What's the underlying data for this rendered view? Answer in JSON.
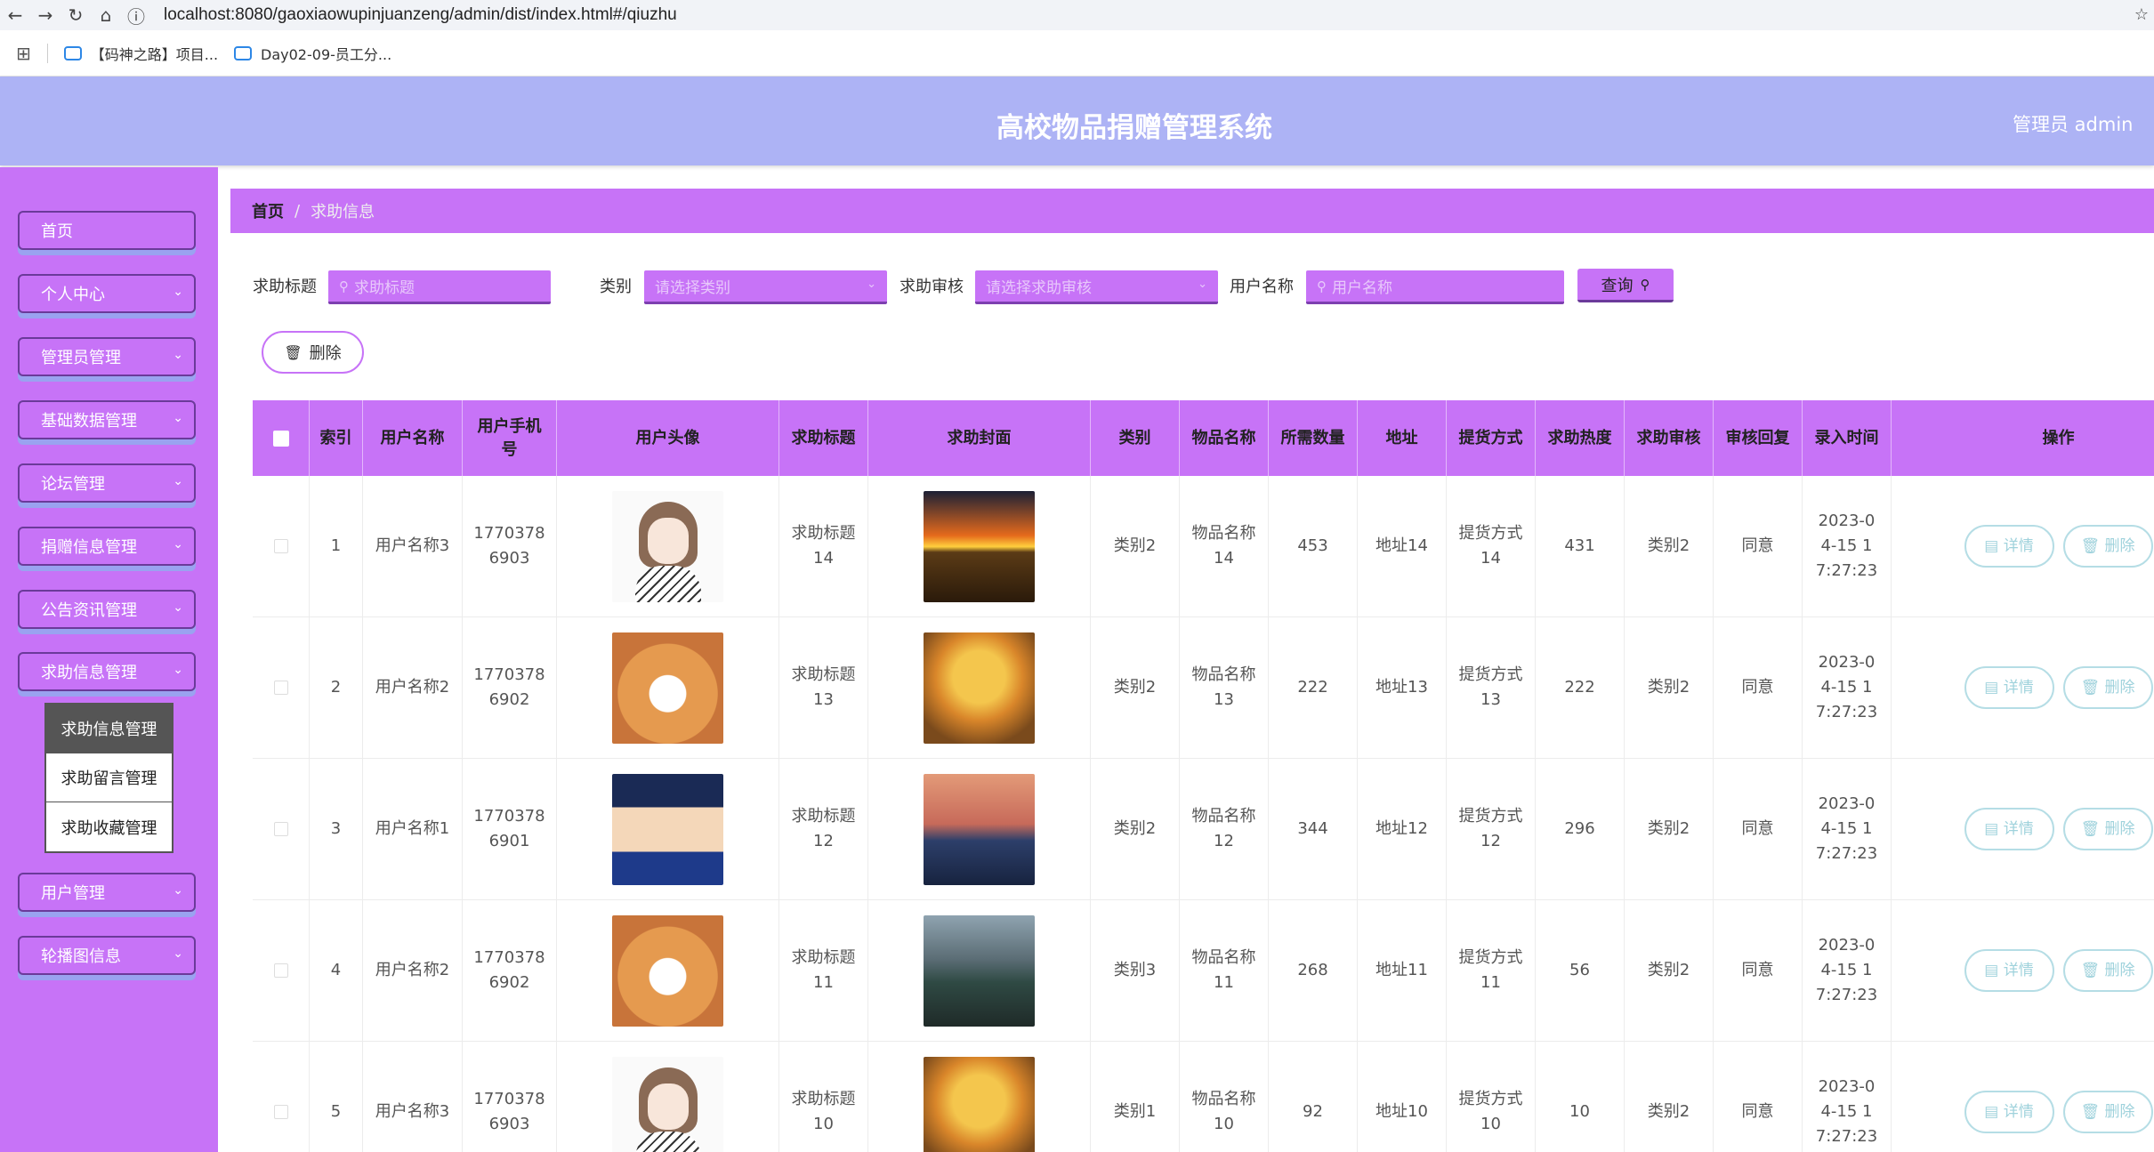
{
  "browser": {
    "url": "localhost:8080/gaoxiaowupinjuanzeng/admin/dist/index.html#/qiuzhu",
    "bookmarks": [
      "【码神之路】项目...",
      "Day02-09-员工分..."
    ]
  },
  "header": {
    "title": "高校物品捐赠管理系统",
    "user": "管理员 admin"
  },
  "sidebar": {
    "items": [
      {
        "label": "首页"
      },
      {
        "label": "个人中心"
      },
      {
        "label": "管理员管理"
      },
      {
        "label": "基础数据管理"
      },
      {
        "label": "论坛管理"
      },
      {
        "label": "捐赠信息管理"
      },
      {
        "label": "公告资讯管理"
      },
      {
        "label": "求助信息管理"
      },
      {
        "label": "用户管理"
      },
      {
        "label": "轮播图信息"
      }
    ],
    "submenu": [
      {
        "label": "求助信息管理"
      },
      {
        "label": "求助留言管理"
      },
      {
        "label": "求助收藏管理"
      }
    ]
  },
  "breadcrumb": {
    "home": "首页",
    "sep": "/",
    "current": "求助信息"
  },
  "search": {
    "title_label": "求助标题",
    "title_placeholder": "求助标题",
    "category_label": "类别",
    "category_placeholder": "请选择类别",
    "review_label": "求助审核",
    "review_placeholder": "请选择求助审核",
    "user_label": "用户名称",
    "user_placeholder": "用户名称",
    "query_label": "查询"
  },
  "delete_label": "删除",
  "table": {
    "headers": [
      "索引",
      "用户名称",
      "用户手机号",
      "用户头像",
      "求助标题",
      "求助封面",
      "类别",
      "物品名称",
      "所需数量",
      "地址",
      "提货方式",
      "求助热度",
      "求助审核",
      "审核回复",
      "录入时间",
      "操作"
    ],
    "rows": [
      {
        "index": "1",
        "user": "用户名称3",
        "phone": "17703786903",
        "title": "求助标题14",
        "category": "类别2",
        "item": "物品名称14",
        "qty": "453",
        "addr": "地址14",
        "pickup": "提货方式14",
        "heat": "431",
        "review": "类别2",
        "reply": "同意",
        "time": "2023-04-15 17:27:23"
      },
      {
        "index": "2",
        "user": "用户名称2",
        "phone": "17703786902",
        "title": "求助标题13",
        "category": "类别2",
        "item": "物品名称13",
        "qty": "222",
        "addr": "地址13",
        "pickup": "提货方式13",
        "heat": "222",
        "review": "类别2",
        "reply": "同意",
        "time": "2023-04-15 17:27:23"
      },
      {
        "index": "3",
        "user": "用户名称1",
        "phone": "17703786901",
        "title": "求助标题12",
        "category": "类别2",
        "item": "物品名称12",
        "qty": "344",
        "addr": "地址12",
        "pickup": "提货方式12",
        "heat": "296",
        "review": "类别2",
        "reply": "同意",
        "time": "2023-04-15 17:27:23"
      },
      {
        "index": "4",
        "user": "用户名称2",
        "phone": "17703786902",
        "title": "求助标题11",
        "category": "类别3",
        "item": "物品名称11",
        "qty": "268",
        "addr": "地址11",
        "pickup": "提货方式11",
        "heat": "56",
        "review": "类别2",
        "reply": "同意",
        "time": "2023-04-15 17:27:23"
      },
      {
        "index": "5",
        "user": "用户名称3",
        "phone": "17703786903",
        "title": "求助标题10",
        "category": "类别1",
        "item": "物品名称10",
        "qty": "92",
        "addr": "地址10",
        "pickup": "提货方式10",
        "heat": "10",
        "review": "类别2",
        "reply": "同意",
        "time": "2023-04-15 17:27:23"
      }
    ],
    "detail_label": "详情",
    "delete_label": "删除"
  }
}
